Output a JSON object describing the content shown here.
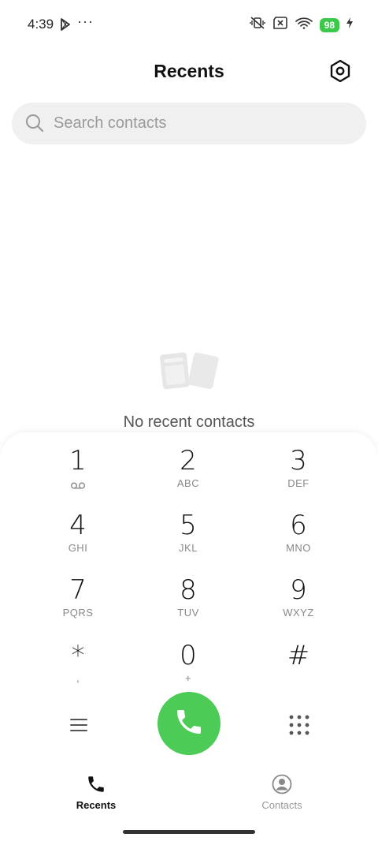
{
  "status_bar": {
    "time": "4:39",
    "more": "···",
    "battery": "98"
  },
  "header": {
    "title": "Recents"
  },
  "search": {
    "placeholder": "Search contacts",
    "value": ""
  },
  "empty_state": {
    "message": "No recent contacts"
  },
  "dialpad": {
    "keys": [
      {
        "digit": "1",
        "letters": ""
      },
      {
        "digit": "2",
        "letters": "ABC"
      },
      {
        "digit": "3",
        "letters": "DEF"
      },
      {
        "digit": "4",
        "letters": "GHI"
      },
      {
        "digit": "5",
        "letters": "JKL"
      },
      {
        "digit": "6",
        "letters": "MNO"
      },
      {
        "digit": "7",
        "letters": "PQRS"
      },
      {
        "digit": "8",
        "letters": "TUV"
      },
      {
        "digit": "9",
        "letters": "WXYZ"
      },
      {
        "digit": "*",
        "letters": ","
      },
      {
        "digit": "0",
        "letters": "+"
      },
      {
        "digit": "#",
        "letters": ""
      }
    ]
  },
  "bottom_nav": {
    "tabs": [
      {
        "label": "Recents",
        "active": true
      },
      {
        "label": "Contacts",
        "active": false
      }
    ]
  },
  "colors": {
    "call_green": "#4ccb57",
    "battery_green": "#3cc84a",
    "search_bg": "#f0f0f0"
  },
  "icons": [
    "play-store-icon",
    "mute-vibrate-icon",
    "no-sim-icon",
    "wifi-icon",
    "charging-icon",
    "settings-icon",
    "search-icon",
    "voicemail-icon",
    "menu-icon",
    "phone-icon",
    "dialpad-icon",
    "contacts-icon"
  ]
}
